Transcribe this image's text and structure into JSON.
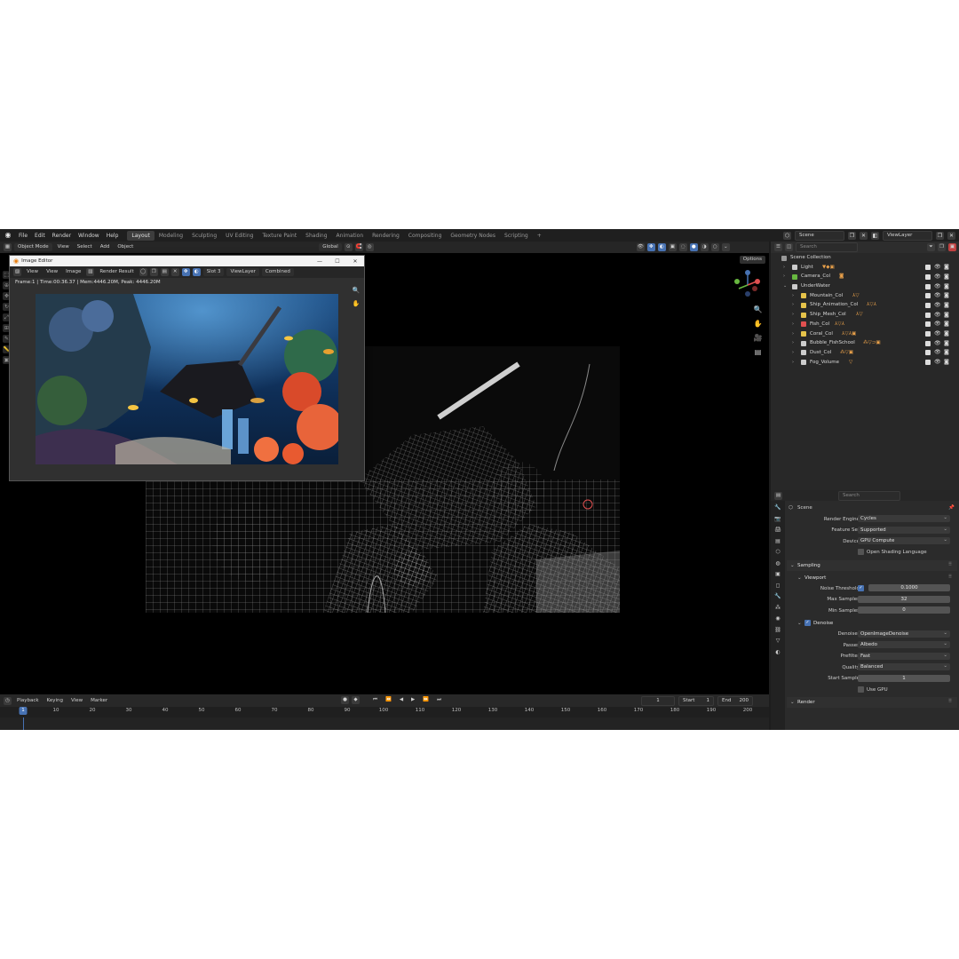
{
  "menu": [
    "File",
    "Edit",
    "Render",
    "Window",
    "Help"
  ],
  "workspaces": [
    "Layout",
    "Modeling",
    "Sculpting",
    "UV Editing",
    "Texture Paint",
    "Shading",
    "Animation",
    "Rendering",
    "Compositing",
    "Geometry Nodes",
    "Scripting"
  ],
  "active_workspace": "Layout",
  "add_workspace": "+",
  "top_right": {
    "scene": "Scene",
    "view_layer": "ViewLayer"
  },
  "viewport_header": {
    "mode": "Object Mode",
    "view": "View",
    "select": "Select",
    "add": "Add",
    "object": "Object",
    "transform": "Global",
    "options": "Options"
  },
  "image_editor": {
    "window_title": "Image Editor",
    "menu_view": "View",
    "menu_view2": "View",
    "menu_image": "Image",
    "image_name": "Render Result",
    "slot": "Slot 3",
    "view_layer": "ViewLayer",
    "pass": "Combined",
    "info": "Frame:1 | Time:00:36.37 | Mem:4446.20M, Peak: 4446.20M"
  },
  "timeline": {
    "playback": "Playback",
    "keying": "Keying",
    "view": "View",
    "marker": "Marker",
    "current_frame": "1",
    "start_label": "Start",
    "start": "1",
    "end_label": "End",
    "end": "200",
    "cursor": "1",
    "ticks": [
      "10",
      "20",
      "30",
      "40",
      "50",
      "60",
      "70",
      "80",
      "90",
      "100",
      "110",
      "120",
      "130",
      "140",
      "150",
      "160",
      "170",
      "180",
      "190",
      "200"
    ]
  },
  "outliner": {
    "search_placeholder": "Search",
    "root": "Scene Collection",
    "items": [
      {
        "name": "Light",
        "color": "#cccccc"
      },
      {
        "name": "Camera_Col",
        "color": "#68b840"
      },
      {
        "name": "UnderWater",
        "color": "#cccccc"
      },
      {
        "name": "Mountain_Col",
        "color": "#e6c34a"
      },
      {
        "name": "Ship_Animation_Col",
        "color": "#e6c34a"
      },
      {
        "name": "Ship_Mesh_Col",
        "color": "#e6c34a"
      },
      {
        "name": "Fish_Col",
        "color": "#e05050"
      },
      {
        "name": "Coral_Col",
        "color": "#e6c34a"
      },
      {
        "name": "Bubble_FishSchool",
        "color": "#cccccc"
      },
      {
        "name": "Dust_Col",
        "color": "#cccccc"
      },
      {
        "name": "Fog_Volume",
        "color": "#cccccc"
      }
    ]
  },
  "properties": {
    "search_placeholder": "Search",
    "context": "Scene",
    "render_engine_label": "Render Engine",
    "render_engine": "Cycles",
    "feature_set_label": "Feature Set",
    "feature_set": "Supported",
    "device_label": "Device",
    "device": "GPU Compute",
    "osl_label": "Open Shading Language",
    "sampling": "Sampling",
    "viewport": "Viewport",
    "noise_threshold_label": "Noise Threshold",
    "noise_threshold": "0.1000",
    "max_samples_label": "Max Samples",
    "max_samples": "32",
    "min_samples_label": "Min Samples",
    "min_samples": "0",
    "denoise": "Denoise",
    "denoiser_label": "Denoiser",
    "denoiser": "OpenImageDenoise",
    "passes_label": "Passes",
    "passes": "Albedo",
    "prefilter_label": "Prefilter",
    "prefilter": "Fast",
    "quality_label": "Quality",
    "quality": "Balanced",
    "start_sample_label": "Start Sample",
    "start_sample": "1",
    "use_gpu_label": "Use GPU",
    "render": "Render"
  },
  "colors": {
    "accent": "#4772b3",
    "header": "#1f1f1f",
    "viewport_bg": "#000000",
    "modifier_orange": "#e8a04a"
  }
}
